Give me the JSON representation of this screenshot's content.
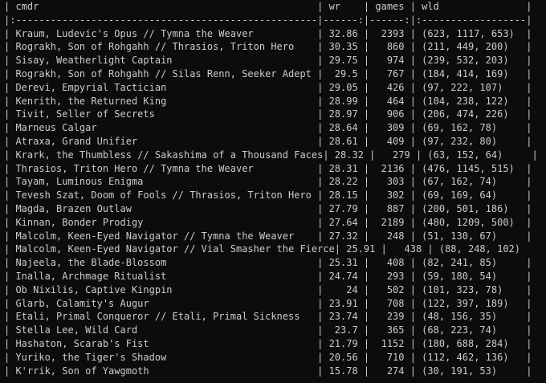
{
  "table": {
    "header_line": "| cmdr                                                | wr    | games | wld               |",
    "separator_line": "|:----------------------------------------------------|------:|------:|:------------------|",
    "columns": [
      "cmdr",
      "wr",
      "games",
      "wld"
    ],
    "rows": [
      {
        "cmdr": "Kraum, Ludevic's Opus // Tymna the Weaver",
        "wr": "32.86",
        "games": "2393",
        "wld": "(623, 1117, 653)"
      },
      {
        "cmdr": "Rograkh, Son of Rohgahh // Thrasios, Triton Hero",
        "wr": "30.35",
        "games": "860",
        "wld": "(211, 449, 200)"
      },
      {
        "cmdr": "Sisay, Weatherlight Captain",
        "wr": "29.75",
        "games": "974",
        "wld": "(239, 532, 203)"
      },
      {
        "cmdr": "Rograkh, Son of Rohgahh // Silas Renn, Seeker Adept",
        "wr": "29.5",
        "games": "767",
        "wld": "(184, 414, 169)"
      },
      {
        "cmdr": "Derevi, Empyrial Tactician",
        "wr": "29.05",
        "games": "426",
        "wld": "(97, 222, 107)"
      },
      {
        "cmdr": "Kenrith, the Returned King",
        "wr": "28.99",
        "games": "464",
        "wld": "(104, 238, 122)"
      },
      {
        "cmdr": "Tivit, Seller of Secrets",
        "wr": "28.97",
        "games": "906",
        "wld": "(206, 474, 226)"
      },
      {
        "cmdr": "Marneus Calgar",
        "wr": "28.64",
        "games": "309",
        "wld": "(69, 162, 78)"
      },
      {
        "cmdr": "Atraxa, Grand Unifier",
        "wr": "28.61",
        "games": "409",
        "wld": "(97, 232, 80)"
      },
      {
        "cmdr": "Krark, the Thumbless // Sakashima of a Thousand Faces",
        "wr": "28.32",
        "games": "279",
        "wld": "(63, 152, 64)"
      },
      {
        "cmdr": "Thrasios, Triton Hero // Tymna the Weaver",
        "wr": "28.31",
        "games": "2136",
        "wld": "(476, 1145, 515)"
      },
      {
        "cmdr": "Tayam, Luminous Enigma",
        "wr": "28.22",
        "games": "303",
        "wld": "(67, 162, 74)"
      },
      {
        "cmdr": "Tevesh Szat, Doom of Fools // Thrasios, Triton Hero",
        "wr": "28.15",
        "games": "302",
        "wld": "(69, 169, 64)"
      },
      {
        "cmdr": "Magda, Brazen Outlaw",
        "wr": "27.79",
        "games": "887",
        "wld": "(200, 501, 186)"
      },
      {
        "cmdr": "Kinnan, Bonder Prodigy",
        "wr": "27.64",
        "games": "2189",
        "wld": "(480, 1209, 500)"
      },
      {
        "cmdr": "Malcolm, Keen-Eyed Navigator // Tymna the Weaver",
        "wr": "27.32",
        "games": "248",
        "wld": "(51, 130, 67)"
      },
      {
        "cmdr": "Malcolm, Keen-Eyed Navigator // Vial Smasher the Fierce",
        "wr": "25.91",
        "games": "438",
        "wld": "(88, 248, 102)"
      },
      {
        "cmdr": "Najeela, the Blade-Blossom",
        "wr": "25.31",
        "games": "408",
        "wld": "(82, 241, 85)"
      },
      {
        "cmdr": "Inalla, Archmage Ritualist",
        "wr": "24.74",
        "games": "293",
        "wld": "(59, 180, 54)"
      },
      {
        "cmdr": "Ob Nixilis, Captive Kingpin",
        "wr": "24",
        "games": "502",
        "wld": "(101, 323, 78)"
      },
      {
        "cmdr": "Glarb, Calamity's Augur",
        "wr": "23.91",
        "games": "708",
        "wld": "(122, 397, 189)"
      },
      {
        "cmdr": "Etali, Primal Conqueror // Etali, Primal Sickness",
        "wr": "23.74",
        "games": "239",
        "wld": "(48, 156, 35)"
      },
      {
        "cmdr": "Stella Lee, Wild Card",
        "wr": "23.7",
        "games": "365",
        "wld": "(68, 223, 74)"
      },
      {
        "cmdr": "Hashaton, Scarab's Fist",
        "wr": "21.79",
        "games": "1152",
        "wld": "(180, 688, 284)"
      },
      {
        "cmdr": "Yuriko, the Tiger's Shadow",
        "wr": "20.56",
        "games": "710",
        "wld": "(112, 462, 136)"
      },
      {
        "cmdr": "K'rrik, Son of Yawgmoth",
        "wr": "15.78",
        "games": "274",
        "wld": "(30, 191, 53)"
      }
    ]
  }
}
